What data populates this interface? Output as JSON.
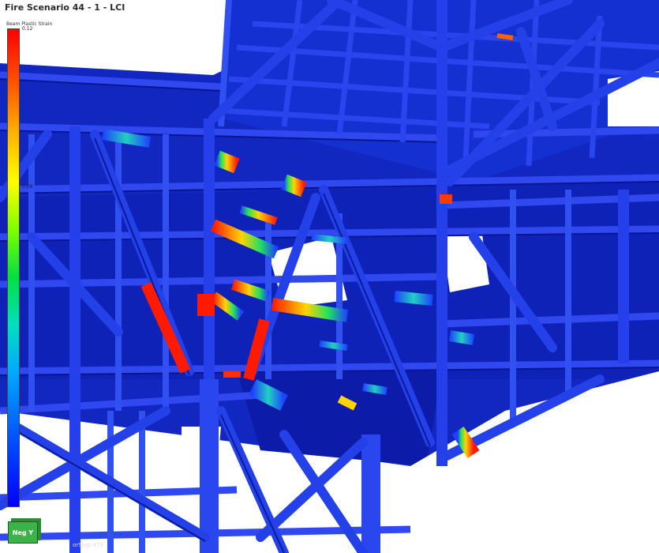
{
  "window": {
    "title": "Fire Scenario 44 - 1 - LCI"
  },
  "legend": {
    "title": "Beam Plastic Strain",
    "max_label": "0.12",
    "mid_label": "0.08"
  },
  "view": {
    "axis_label": "Neg Y",
    "status_text": "orStep 470"
  },
  "colors": {
    "structure": "#1022c8",
    "structure_dark": "#08127a",
    "hot": "#ff1a00",
    "warm": "#ffd400",
    "cool": "#20e060",
    "background": "#ffffff"
  },
  "icons": [
    "axis-cube-icon"
  ]
}
